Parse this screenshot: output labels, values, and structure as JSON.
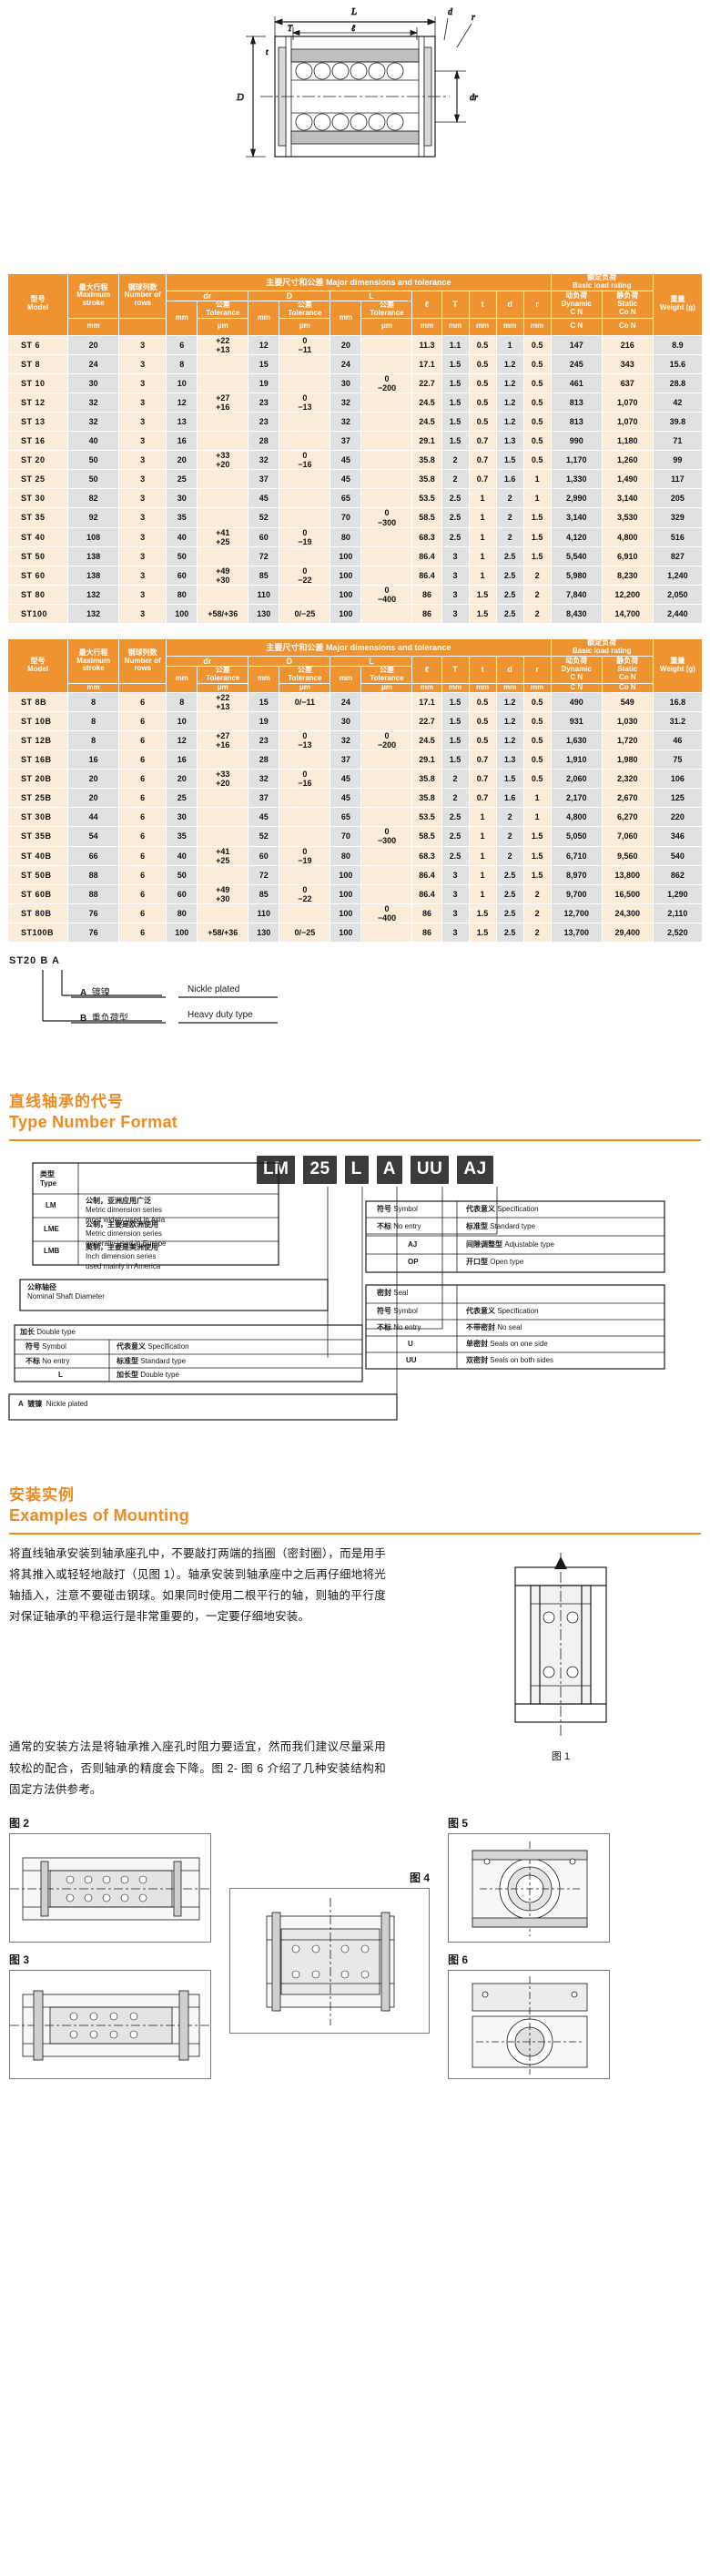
{
  "drawing": {
    "labels": [
      "L",
      "d",
      "r",
      "T",
      "t",
      "D",
      "dr",
      "ℓ"
    ]
  },
  "table1": {
    "header": {
      "model": {
        "cn": "型号",
        "en": "Model"
      },
      "stroke": {
        "cn": "最大行程",
        "en": "Maximum stroke",
        "unit": "mm"
      },
      "rows": {
        "cn": "钢球列数",
        "en": "Number of rows"
      },
      "major": {
        "cn": "主要尺寸和公差",
        "en": "Major dimensions and tolerance"
      },
      "dr": "dr",
      "D": "D",
      "L": "L",
      "l": "ℓ",
      "T": "T",
      "t": "t",
      "d": "d",
      "r": "r",
      "tolerance": {
        "cn": "公差",
        "en": "Tolerance",
        "unit": "μm"
      },
      "mm": "mm",
      "load": {
        "cn": "额定负荷",
        "en": "Basic load rating"
      },
      "dynamic": {
        "cn": "动负荷",
        "en": "Dynamic",
        "sym": "C N"
      },
      "static": {
        "cn": "静负荷",
        "en": "Static",
        "sym": "Co N"
      },
      "weight": {
        "cn": "重量",
        "en": "Weight",
        "unit": "(g)"
      }
    },
    "rows": [
      {
        "model": "ST  6",
        "stroke": "20",
        "nrows": "3",
        "dr": "6",
        "drtol": "+22\n+13",
        "D": "12",
        "Dtol": "0\n−11",
        "L": "20",
        "Ltol": "",
        "l": "11.3",
        "T": "1.1",
        "t": "0.5",
        "d": "1",
        "r": "0.5",
        "C": "147",
        "Co": "216",
        "W": "8.9"
      },
      {
        "model": "ST  8",
        "stroke": "24",
        "nrows": "3",
        "dr": "8",
        "drtol": "",
        "D": "15",
        "Dtol": "",
        "L": "24",
        "Ltol": "",
        "l": "17.1",
        "T": "1.5",
        "t": "0.5",
        "d": "1.2",
        "r": "0.5",
        "C": "245",
        "Co": "343",
        "W": "15.6"
      },
      {
        "model": "ST 10",
        "stroke": "30",
        "nrows": "3",
        "dr": "10",
        "drtol": "",
        "D": "19",
        "Dtol": "",
        "L": "30",
        "Ltol": "0\n−200",
        "l": "22.7",
        "T": "1.5",
        "t": "0.5",
        "d": "1.2",
        "r": "0.5",
        "C": "461",
        "Co": "637",
        "W": "28.8"
      },
      {
        "model": "ST 12",
        "stroke": "32",
        "nrows": "3",
        "dr": "12",
        "drtol": "+27\n+16",
        "D": "23",
        "Dtol": "0\n−13",
        "L": "32",
        "Ltol": "",
        "l": "24.5",
        "T": "1.5",
        "t": "0.5",
        "d": "1.2",
        "r": "0.5",
        "C": "813",
        "Co": "1,070",
        "W": "42"
      },
      {
        "model": "ST 13",
        "stroke": "32",
        "nrows": "3",
        "dr": "13",
        "drtol": "",
        "D": "23",
        "Dtol": "",
        "L": "32",
        "Ltol": "",
        "l": "24.5",
        "T": "1.5",
        "t": "0.5",
        "d": "1.2",
        "r": "0.5",
        "C": "813",
        "Co": "1,070",
        "W": "39.8"
      },
      {
        "model": "ST 16",
        "stroke": "40",
        "nrows": "3",
        "dr": "16",
        "drtol": "",
        "D": "28",
        "Dtol": "",
        "L": "37",
        "Ltol": "",
        "l": "29.1",
        "T": "1.5",
        "t": "0.7",
        "d": "1.3",
        "r": "0.5",
        "C": "990",
        "Co": "1,180",
        "W": "71"
      },
      {
        "model": "ST 20",
        "stroke": "50",
        "nrows": "3",
        "dr": "20",
        "drtol": "+33\n+20",
        "D": "32",
        "Dtol": "0\n−16",
        "L": "45",
        "Ltol": "",
        "l": "35.8",
        "T": "2",
        "t": "0.7",
        "d": "1.5",
        "r": "0.5",
        "C": "1,170",
        "Co": "1,260",
        "W": "99"
      },
      {
        "model": "ST 25",
        "stroke": "50",
        "nrows": "3",
        "dr": "25",
        "drtol": "",
        "D": "37",
        "Dtol": "",
        "L": "45",
        "Ltol": "",
        "l": "35.8",
        "T": "2",
        "t": "0.7",
        "d": "1.6",
        "r": "1",
        "C": "1,330",
        "Co": "1,490",
        "W": "117"
      },
      {
        "model": "ST 30",
        "stroke": "82",
        "nrows": "3",
        "dr": "30",
        "drtol": "",
        "D": "45",
        "Dtol": "",
        "L": "65",
        "Ltol": "",
        "l": "53.5",
        "T": "2.5",
        "t": "1",
        "d": "2",
        "r": "1",
        "C": "2,990",
        "Co": "3,140",
        "W": "205"
      },
      {
        "model": "ST 35",
        "stroke": "92",
        "nrows": "3",
        "dr": "35",
        "drtol": "",
        "D": "52",
        "Dtol": "",
        "L": "70",
        "Ltol": "0\n−300",
        "l": "58.5",
        "T": "2.5",
        "t": "1",
        "d": "2",
        "r": "1.5",
        "C": "3,140",
        "Co": "3,530",
        "W": "329"
      },
      {
        "model": "ST 40",
        "stroke": "108",
        "nrows": "3",
        "dr": "40",
        "drtol": "+41\n+25",
        "D": "60",
        "Dtol": "0\n−19",
        "L": "80",
        "Ltol": "",
        "l": "68.3",
        "T": "2.5",
        "t": "1",
        "d": "2",
        "r": "1.5",
        "C": "4,120",
        "Co": "4,800",
        "W": "516"
      },
      {
        "model": "ST 50",
        "stroke": "138",
        "nrows": "3",
        "dr": "50",
        "drtol": "",
        "D": "72",
        "Dtol": "",
        "L": "100",
        "Ltol": "",
        "l": "86.4",
        "T": "3",
        "t": "1",
        "d": "2.5",
        "r": "1.5",
        "C": "5,540",
        "Co": "6,910",
        "W": "827"
      },
      {
        "model": "ST 60",
        "stroke": "138",
        "nrows": "3",
        "dr": "60",
        "drtol": "+49\n+30",
        "D": "85",
        "Dtol": "0\n−22",
        "L": "100",
        "Ltol": "",
        "l": "86.4",
        "T": "3",
        "t": "1",
        "d": "2.5",
        "r": "2",
        "C": "5,980",
        "Co": "8,230",
        "W": "1,240"
      },
      {
        "model": "ST 80",
        "stroke": "132",
        "nrows": "3",
        "dr": "80",
        "drtol": "",
        "D": "110",
        "Dtol": "",
        "L": "100",
        "Ltol": "0\n−400",
        "l": "86",
        "T": "3",
        "t": "1.5",
        "d": "2.5",
        "r": "2",
        "C": "7,840",
        "Co": "12,200",
        "W": "2,050"
      },
      {
        "model": "ST100",
        "stroke": "132",
        "nrows": "3",
        "dr": "100",
        "drtol": "+58/+36",
        "D": "130",
        "Dtol": "0/−25",
        "L": "100",
        "Ltol": "",
        "l": "86",
        "T": "3",
        "t": "1.5",
        "d": "2.5",
        "r": "2",
        "C": "8,430",
        "Co": "14,700",
        "W": "2,440"
      }
    ]
  },
  "table2": {
    "rows": [
      {
        "model": "ST  8B",
        "stroke": "8",
        "nrows": "6",
        "dr": "8",
        "drtol": "+22\n+13",
        "D": "15",
        "Dtol": "0/−11",
        "L": "24",
        "Ltol": "",
        "l": "17.1",
        "T": "1.5",
        "t": "0.5",
        "d": "1.2",
        "r": "0.5",
        "C": "490",
        "Co": "549",
        "W": "16.8"
      },
      {
        "model": "ST 10B",
        "stroke": "8",
        "nrows": "6",
        "dr": "10",
        "drtol": "",
        "D": "19",
        "Dtol": "",
        "L": "30",
        "Ltol": "",
        "l": "22.7",
        "T": "1.5",
        "t": "0.5",
        "d": "1.2",
        "r": "0.5",
        "C": "931",
        "Co": "1,030",
        "W": "31.2"
      },
      {
        "model": "ST 12B",
        "stroke": "8",
        "nrows": "6",
        "dr": "12",
        "drtol": "+27\n+16",
        "D": "23",
        "Dtol": "0\n−13",
        "L": "32",
        "Ltol": "0\n−200",
        "l": "24.5",
        "T": "1.5",
        "t": "0.5",
        "d": "1.2",
        "r": "0.5",
        "C": "1,630",
        "Co": "1,720",
        "W": "46"
      },
      {
        "model": "ST 16B",
        "stroke": "16",
        "nrows": "6",
        "dr": "16",
        "drtol": "",
        "D": "28",
        "Dtol": "",
        "L": "37",
        "Ltol": "",
        "l": "29.1",
        "T": "1.5",
        "t": "0.7",
        "d": "1.3",
        "r": "0.5",
        "C": "1,910",
        "Co": "1,980",
        "W": "75"
      },
      {
        "model": "ST 20B",
        "stroke": "20",
        "nrows": "6",
        "dr": "20",
        "drtol": "+33\n+20",
        "D": "32",
        "Dtol": "0\n−16",
        "L": "45",
        "Ltol": "",
        "l": "35.8",
        "T": "2",
        "t": "0.7",
        "d": "1.5",
        "r": "0.5",
        "C": "2,060",
        "Co": "2,320",
        "W": "106"
      },
      {
        "model": "ST 25B",
        "stroke": "20",
        "nrows": "6",
        "dr": "25",
        "drtol": "",
        "D": "37",
        "Dtol": "",
        "L": "45",
        "Ltol": "",
        "l": "35.8",
        "T": "2",
        "t": "0.7",
        "d": "1.6",
        "r": "1",
        "C": "2,170",
        "Co": "2,670",
        "W": "125"
      },
      {
        "model": "ST 30B",
        "stroke": "44",
        "nrows": "6",
        "dr": "30",
        "drtol": "",
        "D": "45",
        "Dtol": "",
        "L": "65",
        "Ltol": "",
        "l": "53.5",
        "T": "2.5",
        "t": "1",
        "d": "2",
        "r": "1",
        "C": "4,800",
        "Co": "6,270",
        "W": "220"
      },
      {
        "model": "ST 35B",
        "stroke": "54",
        "nrows": "6",
        "dr": "35",
        "drtol": "",
        "D": "52",
        "Dtol": "",
        "L": "70",
        "Ltol": "0\n−300",
        "l": "58.5",
        "T": "2.5",
        "t": "1",
        "d": "2",
        "r": "1.5",
        "C": "5,050",
        "Co": "7,060",
        "W": "346"
      },
      {
        "model": "ST 40B",
        "stroke": "66",
        "nrows": "6",
        "dr": "40",
        "drtol": "+41\n+25",
        "D": "60",
        "Dtol": "0\n−19",
        "L": "80",
        "Ltol": "",
        "l": "68.3",
        "T": "2.5",
        "t": "1",
        "d": "2",
        "r": "1.5",
        "C": "6,710",
        "Co": "9,560",
        "W": "540"
      },
      {
        "model": "ST 50B",
        "stroke": "88",
        "nrows": "6",
        "dr": "50",
        "drtol": "",
        "D": "72",
        "Dtol": "",
        "L": "100",
        "Ltol": "",
        "l": "86.4",
        "T": "3",
        "t": "1",
        "d": "2.5",
        "r": "1.5",
        "C": "8,970",
        "Co": "13,800",
        "W": "862"
      },
      {
        "model": "ST 60B",
        "stroke": "88",
        "nrows": "6",
        "dr": "60",
        "drtol": "+49\n+30",
        "D": "85",
        "Dtol": "0\n−22",
        "L": "100",
        "Ltol": "",
        "l": "86.4",
        "T": "3",
        "t": "1",
        "d": "2.5",
        "r": "2",
        "C": "9,700",
        "Co": "16,500",
        "W": "1,290"
      },
      {
        "model": "ST 80B",
        "stroke": "76",
        "nrows": "6",
        "dr": "80",
        "drtol": "",
        "D": "110",
        "Dtol": "",
        "L": "100",
        "Ltol": "0\n−400",
        "l": "86",
        "T": "3",
        "t": "1.5",
        "d": "2.5",
        "r": "2",
        "C": "12,700",
        "Co": "24,300",
        "W": "2,110"
      },
      {
        "model": "ST100B",
        "stroke": "76",
        "nrows": "6",
        "dr": "100",
        "drtol": "+58/+36",
        "D": "130",
        "Dtol": "0/−25",
        "L": "100",
        "Ltol": "",
        "l": "86",
        "T": "3",
        "t": "1.5",
        "d": "2.5",
        "r": "2",
        "C": "13,700",
        "Co": "29,400",
        "W": "2,520"
      }
    ]
  },
  "st_legend": {
    "code": "ST20 B  A",
    "rows": [
      {
        "sym": "A",
        "cn": "镀镍",
        "en": "Nickle plated"
      },
      {
        "sym": "B",
        "cn": "重负荷型",
        "en": "Heavy duty type"
      }
    ]
  },
  "type_format": {
    "heading_cn": "直线轴承的代号",
    "heading_en": "Type Number Format",
    "chips": [
      "LM",
      "25",
      "L",
      "A",
      "UU",
      "AJ"
    ],
    "type_block": {
      "title_cn": "类型",
      "title_en": "Type",
      "rows": [
        {
          "sym": "LM",
          "cn": "公制，亚洲应用广泛",
          "en1": "Metric dimension series",
          "en2": "most widely used in Asia"
        },
        {
          "sym": "LME",
          "cn": "公制，主要是欧洲使用",
          "en1": "Metric dimension series",
          "en2": "generally used in Europe"
        },
        {
          "sym": "LMB",
          "cn": "英制，主要是美洲使用",
          "en1": "Inch dimension series",
          "en2": "used mainly in America"
        }
      ]
    },
    "shaft": {
      "cn": "公称轴径",
      "en": "Nominal Shaft Diameter"
    },
    "double": {
      "title_cn": "加长",
      "title_en": "Double type",
      "head": {
        "sym_cn": "符号",
        "sym_en": "Symbol",
        "spec_cn": "代表意义",
        "spec_en": "Specification"
      },
      "rows": [
        {
          "sym_cn": "不标",
          "sym_en": "No entry",
          "spec_cn": "标准型",
          "spec_en": "Standard type"
        },
        {
          "sym_cn": "",
          "sym_en": "L",
          "spec_cn": "加长型",
          "spec_en": "Double type"
        }
      ]
    },
    "plated": {
      "sym": "A",
      "cn": "镀镍",
      "en": "Nickle plated"
    },
    "symbol_block": {
      "head": {
        "sym_cn": "符号",
        "sym_en": "Symbol",
        "spec_cn": "代表意义",
        "spec_en": "Specification"
      },
      "rows": [
        {
          "sym_cn": "不标",
          "sym_en": "No entry",
          "spec_cn": "标准型",
          "spec_en": "Standard type"
        },
        {
          "sym_cn": "",
          "sym_en": "AJ",
          "spec_cn": "间隙调整型",
          "spec_en": "Adjustable type"
        },
        {
          "sym_cn": "",
          "sym_en": "OP",
          "spec_cn": "开口型",
          "spec_en": "Open type"
        }
      ]
    },
    "seal_block": {
      "title_cn": "密封",
      "title_en": "Seal",
      "head": {
        "sym_cn": "符号",
        "sym_en": "Symbol",
        "spec_cn": "代表意义",
        "spec_en": "Specification"
      },
      "rows": [
        {
          "sym_cn": "不标",
          "sym_en": "No entry",
          "spec_cn": "不带密封",
          "spec_en": "No seal"
        },
        {
          "sym_cn": "",
          "sym_en": "U",
          "spec_cn": "单密封",
          "spec_en": "Seals on one side"
        },
        {
          "sym_cn": "",
          "sym_en": "UU",
          "spec_cn": "双密封",
          "spec_en": "Seals on both sides"
        }
      ]
    }
  },
  "mounting": {
    "heading_cn": "安装实例",
    "heading_en": "Examples of Mounting",
    "para1": "将直线轴承安装到轴承座孔中，不要敲打两端的挡圈（密封圈），而是用手将其推入或轻轻地敲打（见图 1）。轴承安装到轴承座中之后再仔细地将光轴插入，注意不要碰击钢球。如果同时使用二根平行的轴，则轴的平行度对保证轴承的平稳运行是非常重要的，一定要仔细地安装。",
    "para2": "通常的安装方法是将轴承推入座孔时阻力要适宜，然而我们建议尽量采用较松的配合，否则轴承的精度会下降。图 2- 图 6 介绍了几种安装结构和固定方法供参考。",
    "fig1": "图 1",
    "fig2": "图 2",
    "fig3": "图 3",
    "fig4": "图 4",
    "fig5": "图 5",
    "fig6": "图 6"
  }
}
